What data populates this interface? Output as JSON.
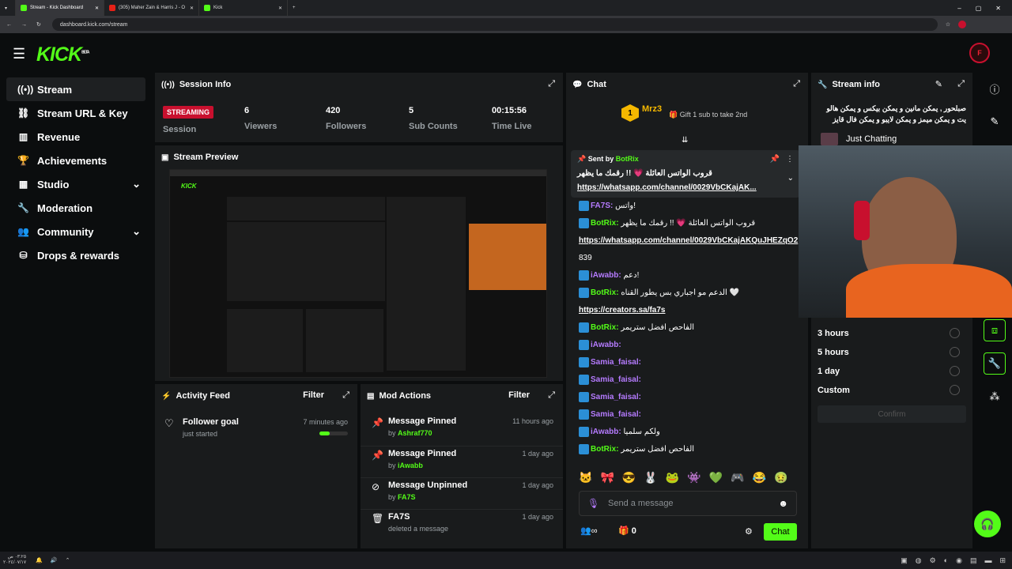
{
  "browser": {
    "tabs": [
      {
        "label": "Stream - Kick Dashboard"
      },
      {
        "label": "(305) Maher Zain & Harris J - O"
      },
      {
        "label": "Kick"
      }
    ],
    "url": "dashboard.kick.com/stream"
  },
  "brand": {
    "logo": "KICK",
    "beta": "BETA",
    "accent": "#53fc18"
  },
  "sidebar": {
    "items": [
      {
        "label": "Stream",
        "icon": "radio-icon"
      },
      {
        "label": "Stream URL & Key",
        "icon": "link-icon"
      },
      {
        "label": "Revenue",
        "icon": "chart-icon"
      },
      {
        "label": "Achievements",
        "icon": "trophy-icon"
      },
      {
        "label": "Studio",
        "icon": "studio-icon"
      },
      {
        "label": "Moderation",
        "icon": "wrench-icon"
      },
      {
        "label": "Community",
        "icon": "community-icon"
      },
      {
        "label": "Drops & rewards",
        "icon": "drops-icon"
      }
    ]
  },
  "session": {
    "title": "Session Info",
    "status": "STREAMING",
    "status_label": "Session",
    "viewers": "6",
    "viewers_label": "Viewers",
    "followers": "420",
    "followers_label": "Followers",
    "subs": "5",
    "subs_label": "Sub Counts",
    "time": "00:15:56",
    "time_label": "Time Live"
  },
  "preview": {
    "title": "Stream Preview"
  },
  "activity": {
    "title": "Activity Feed",
    "filter": "Filter",
    "items": [
      {
        "title": "Follower goal",
        "sub": "just started",
        "time": "7 minutes ago",
        "progress": 0.35
      }
    ]
  },
  "mod": {
    "title": "Mod Actions",
    "filter": "Filter",
    "items": [
      {
        "title": "Message Pinned",
        "by": "by",
        "user": "Ashraf770",
        "time": "11 hours ago"
      },
      {
        "title": "Message Pinned",
        "by": "by",
        "user": "iAwabb",
        "time": "1 day ago"
      },
      {
        "title": "Message Unpinned",
        "by": "by",
        "user": "FA7S",
        "time": "1 day ago"
      },
      {
        "title": "FA7S",
        "by": "deleted a message",
        "user": "",
        "time": "1 day ago"
      }
    ]
  },
  "chat": {
    "title": "Chat",
    "top_user": "Mrz3",
    "top_count": "1",
    "gift_text": "Gift 1 sub to take 2nd",
    "pinned_by": "Sent by",
    "pinned_user": "BotRix",
    "pinned_text": "قروب الواتس العائلة 💗 !! رقمك ما يظهر",
    "pinned_link": "https://whatsapp.com/channel/0029VbCKajAK...",
    "messages": [
      {
        "user": "FA7S:",
        "text": "واتس!",
        "color": "#b57bff"
      },
      {
        "user": "BotRix:",
        "text": "قروب الواتس العائلة 💗 !! رقمك ما يظهر",
        "color": "#53fc18"
      },
      {
        "user": "",
        "text": "https://whatsapp.com/channel/0029VbCKajAKQuJHEZqO2",
        "color": "#fff"
      },
      {
        "user": "",
        "text": "839",
        "color": "#fff"
      },
      {
        "user": "iAwabb:",
        "text": "دعم!",
        "color": "#b57bff"
      },
      {
        "user": "BotRix:",
        "text": "الدعم مو اجباري بس يطور القناه 🤍",
        "color": "#53fc18"
      },
      {
        "user": "",
        "text": "https://creators.sa/fa7s",
        "color": "#fff"
      },
      {
        "user": "BotRix:",
        "text": "الفاحص افضل ستريمر",
        "color": "#53fc18"
      },
      {
        "user": "iAwabb:",
        "text": "",
        "color": "#b57bff"
      },
      {
        "user": "Samia_faisal:",
        "text": "",
        "color": "#b57bff"
      },
      {
        "user": "Samia_faisal:",
        "text": "",
        "color": "#b57bff"
      },
      {
        "user": "Samia_faisal:",
        "text": "",
        "color": "#b57bff"
      },
      {
        "user": "Samia_faisal:",
        "text": "",
        "color": "#b57bff"
      },
      {
        "user": "iAwabb:",
        "text": "ولكم سلميا",
        "color": "#b57bff"
      },
      {
        "user": "BotRix:",
        "text": "الفاحص افضل ستريمر",
        "color": "#53fc18"
      }
    ],
    "placeholder": "Send a message",
    "count": "0",
    "send": "Chat"
  },
  "info": {
    "title": "Stream info",
    "desc": "صبلحور , يمكن مانين و يمكن بيكس و يمكن هالو يت و يمكن ميمز و يمكن لايبو و يمكن فال قايز",
    "category": "Just Chatting",
    "options": [
      "3 hours",
      "5 hours",
      "1 day",
      "Custom"
    ],
    "confirm": "Confirm"
  },
  "taskbar": {
    "time": "٠٣:٢٥ ص",
    "date": "٢٠٢٤/٠٧/١٧"
  }
}
